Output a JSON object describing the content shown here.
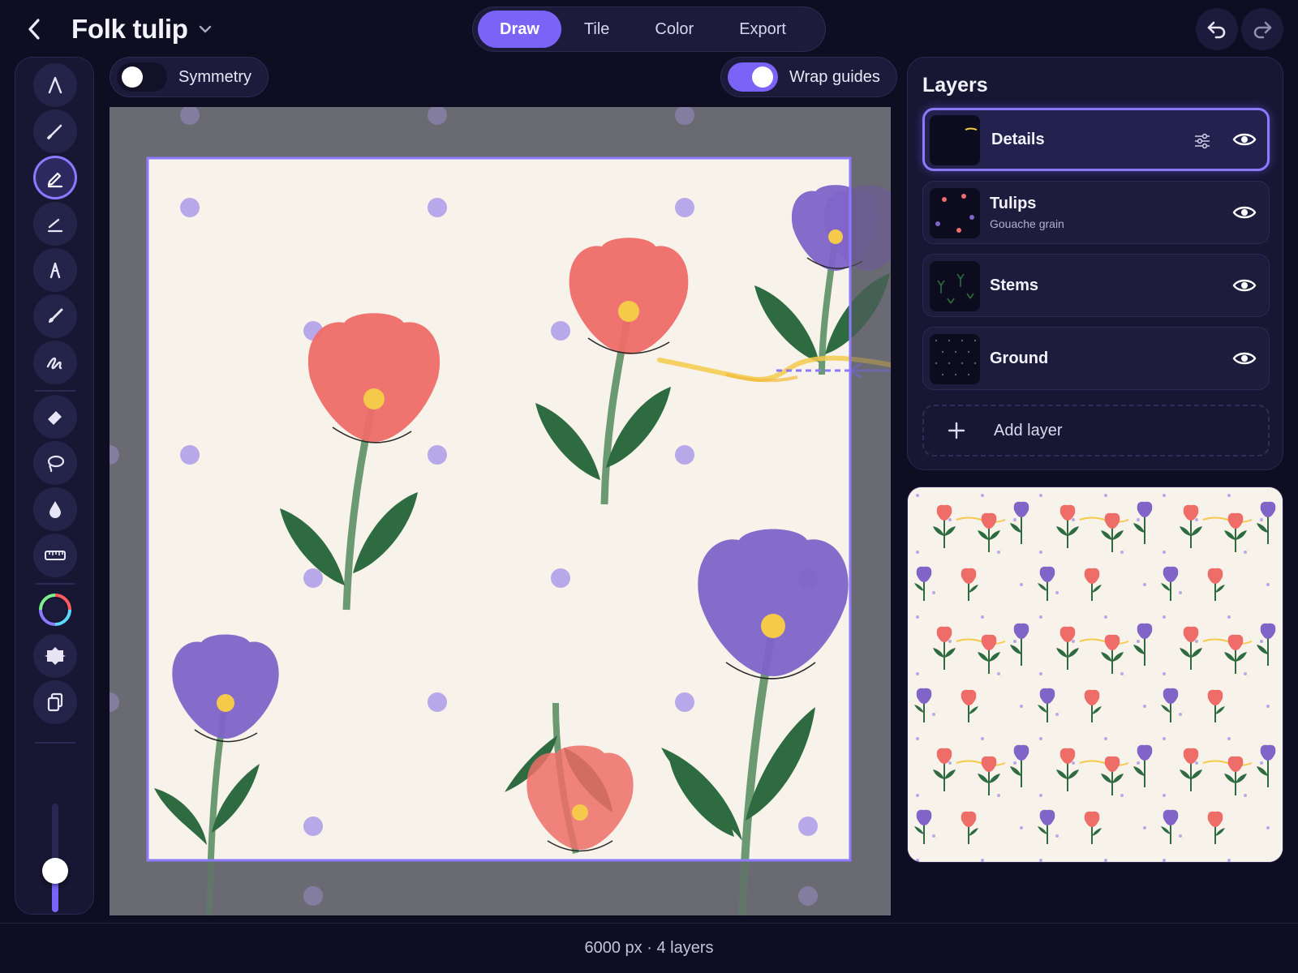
{
  "header": {
    "back_icon": "chevron-left-icon",
    "title": "Folk tulip",
    "title_menu_icon": "chevron-down-icon",
    "modes": [
      "Draw",
      "Tile",
      "Color",
      "Export"
    ],
    "active_mode": "Draw",
    "undo_icon": "undo-icon",
    "redo_icon": "redo-icon"
  },
  "tools": {
    "items": [
      "monoline-pen-icon",
      "fine-liner-icon",
      "pencil-icon",
      "sketch-pencil-icon",
      "ink-pen-icon",
      "paint-brush-icon",
      "smudge-brush-icon",
      "eraser-icon",
      "lasso-icon",
      "blend-drop-icon",
      "ruler-icon",
      "color-wheel-icon",
      "shape-icon",
      "copy-layers-icon"
    ],
    "active": "pencil-icon",
    "brush_size": 0.38
  },
  "canvas_toolbar": {
    "symmetry": {
      "label": "Symmetry",
      "on": false
    },
    "wrap_guides": {
      "label": "Wrap guides",
      "on": true
    }
  },
  "layers": {
    "title": "Layers",
    "items": [
      {
        "name": "Details",
        "subtitle": "",
        "active": true
      },
      {
        "name": "Tulips",
        "subtitle": "Gouache grain",
        "active": false
      },
      {
        "name": "Stems",
        "subtitle": "",
        "active": false
      },
      {
        "name": "Ground",
        "subtitle": "",
        "active": false
      }
    ],
    "add_label": "Add layer"
  },
  "colors": {
    "accent": "#7b63f7",
    "paper": "#f7f3ea",
    "tulip_red": "#ee6d68",
    "tulip_purple": "#8064c8",
    "leaf": "#2e6b40",
    "stem": "#6b9a72",
    "polka_dot": "#b7a8ea",
    "wave": "#f5c94a"
  },
  "status": "6000 px · 4 layers"
}
